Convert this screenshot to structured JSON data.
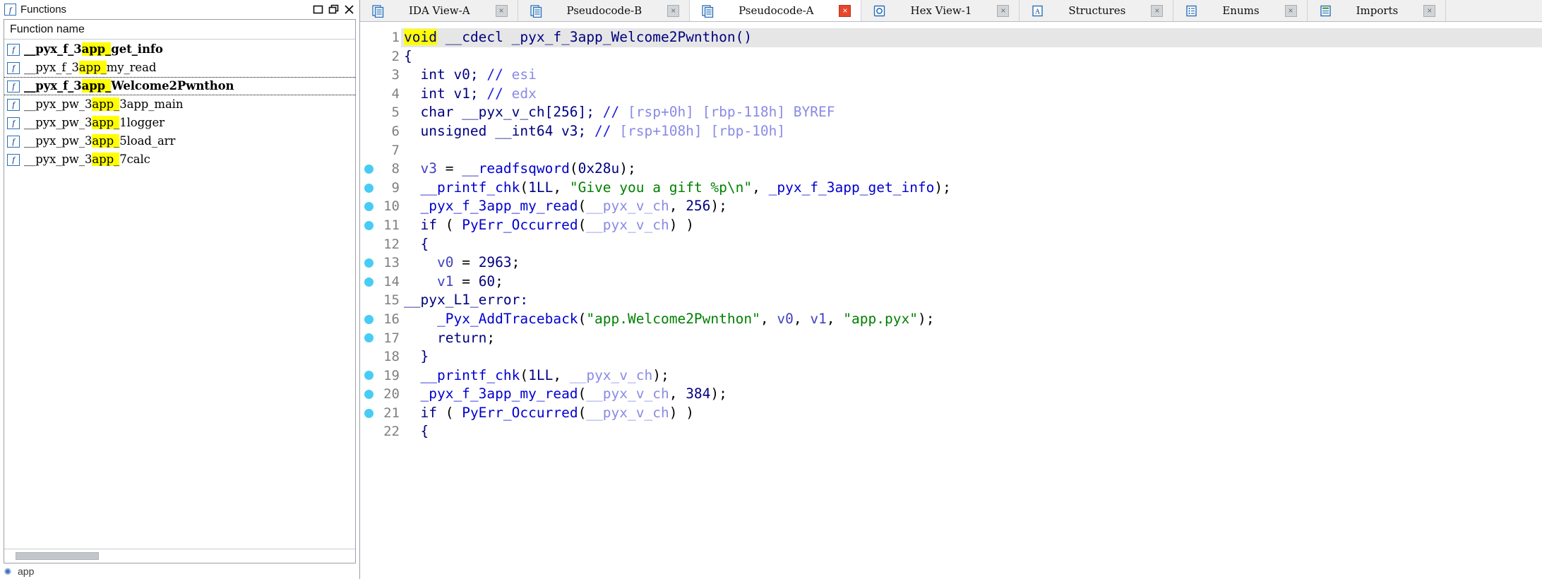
{
  "left_dock": {
    "title": "Functions",
    "title_icon": "function-window-icon",
    "window_buttons": [
      {
        "name": "restore-button",
        "glyph": "restore"
      },
      {
        "name": "maximize-button",
        "glyph": "maximize"
      },
      {
        "name": "close-button",
        "glyph": "close"
      }
    ],
    "column_header": "Function name",
    "functions": [
      {
        "pre": "__pyx_f_3",
        "hl": "app_",
        "post": "get_info",
        "bold": true,
        "selected": false
      },
      {
        "pre": "__pyx_f_3",
        "hl": "app_",
        "post": "my_read",
        "bold": false,
        "selected": false
      },
      {
        "pre": "__pyx_f_3",
        "hl": "app_",
        "post": "Welcome2Pwnthon",
        "bold": true,
        "selected": true
      },
      {
        "pre": "__pyx_pw_3",
        "hl": "app_",
        "post": "3app_main",
        "bold": false,
        "selected": false
      },
      {
        "pre": "__pyx_pw_3",
        "hl": "app_",
        "post": "1logger",
        "bold": false,
        "selected": false
      },
      {
        "pre": "__pyx_pw_3",
        "hl": "app_",
        "post": "5load_arr",
        "bold": false,
        "selected": false
      },
      {
        "pre": "__pyx_pw_3",
        "hl": "app_",
        "post": "7calc",
        "bold": false,
        "selected": false
      }
    ],
    "status_text": "app",
    "status_icon": "python-icon"
  },
  "tabs": [
    {
      "label": "IDA View-A",
      "icon": "document-icon",
      "active": false,
      "closable": true
    },
    {
      "label": "Pseudocode-B",
      "icon": "document-icon",
      "active": false,
      "closable": true
    },
    {
      "label": "Pseudocode-A",
      "icon": "document-icon",
      "active": true,
      "closable": true
    },
    {
      "label": "Hex View-1",
      "icon": "hex-icon",
      "active": false,
      "closable": true
    },
    {
      "label": "Structures",
      "icon": "structures-icon",
      "active": false,
      "closable": true
    },
    {
      "label": "Enums",
      "icon": "enums-icon",
      "active": false,
      "closable": true
    },
    {
      "label": "Imports",
      "icon": "imports-icon",
      "active": false,
      "closable": true
    }
  ],
  "code": {
    "lines": [
      {
        "n": 1,
        "bp": false,
        "hl_row": true,
        "tokens": [
          {
            "t": "void",
            "c": "t-hl"
          },
          {
            "t": " ",
            "c": "t-plain"
          },
          {
            "t": "__cdecl",
            "c": "t-kw"
          },
          {
            "t": " ",
            "c": "t-plain"
          },
          {
            "t": "_pyx_f_3app_Welcome2Pwnthon",
            "c": "t-kw"
          },
          {
            "t": "()",
            "c": "t-kw"
          }
        ]
      },
      {
        "n": 2,
        "bp": false,
        "hl_row": false,
        "tokens": [
          {
            "t": "{",
            "c": "t-kw"
          }
        ]
      },
      {
        "n": 3,
        "bp": false,
        "hl_row": false,
        "tokens": [
          {
            "t": "  int v0; ",
            "c": "t-kw"
          },
          {
            "t": "//",
            "c": "t-cmt"
          },
          {
            "t": " ",
            "c": "t-plain"
          },
          {
            "t": "esi",
            "c": "t-reg"
          }
        ]
      },
      {
        "n": 4,
        "bp": false,
        "hl_row": false,
        "tokens": [
          {
            "t": "  int v1; ",
            "c": "t-kw"
          },
          {
            "t": "//",
            "c": "t-cmt"
          },
          {
            "t": " ",
            "c": "t-plain"
          },
          {
            "t": "edx",
            "c": "t-reg"
          }
        ]
      },
      {
        "n": 5,
        "bp": false,
        "hl_row": false,
        "tokens": [
          {
            "t": "  char __pyx_v_ch[256]; ",
            "c": "t-kw"
          },
          {
            "t": "//",
            "c": "t-cmt"
          },
          {
            "t": " ",
            "c": "t-plain"
          },
          {
            "t": "[rsp+0h] [rbp-118h] BYREF",
            "c": "t-reg"
          }
        ]
      },
      {
        "n": 6,
        "bp": false,
        "hl_row": false,
        "tokens": [
          {
            "t": "  unsigned __int64 v3; ",
            "c": "t-kw"
          },
          {
            "t": "//",
            "c": "t-cmt"
          },
          {
            "t": " ",
            "c": "t-plain"
          },
          {
            "t": "[rsp+108h] [rbp-10h]",
            "c": "t-reg"
          }
        ]
      },
      {
        "n": 7,
        "bp": false,
        "hl_row": false,
        "tokens": []
      },
      {
        "n": 8,
        "bp": true,
        "hl_row": false,
        "tokens": [
          {
            "t": "  ",
            "c": "t-plain"
          },
          {
            "t": "v3",
            "c": "t-var"
          },
          {
            "t": " = ",
            "c": "t-plain"
          },
          {
            "t": "__readfsqword",
            "c": "t-glob"
          },
          {
            "t": "(",
            "c": "t-plain"
          },
          {
            "t": "0x28u",
            "c": "t-num"
          },
          {
            "t": ");",
            "c": "t-plain"
          }
        ]
      },
      {
        "n": 9,
        "bp": true,
        "hl_row": false,
        "tokens": [
          {
            "t": "  ",
            "c": "t-plain"
          },
          {
            "t": "__printf_chk",
            "c": "t-glob"
          },
          {
            "t": "(",
            "c": "t-plain"
          },
          {
            "t": "1LL",
            "c": "t-num"
          },
          {
            "t": ", ",
            "c": "t-plain"
          },
          {
            "t": "\"Give you a gift %p\\n\"",
            "c": "t-str"
          },
          {
            "t": ", ",
            "c": "t-plain"
          },
          {
            "t": "_pyx_f_3app_get_info",
            "c": "t-glob"
          },
          {
            "t": ");",
            "c": "t-plain"
          }
        ]
      },
      {
        "n": 10,
        "bp": true,
        "hl_row": false,
        "tokens": [
          {
            "t": "  ",
            "c": "t-plain"
          },
          {
            "t": "_pyx_f_3app_my_read",
            "c": "t-glob"
          },
          {
            "t": "(",
            "c": "t-plain"
          },
          {
            "t": "__pyx_v_ch",
            "c": "t-reg"
          },
          {
            "t": ", ",
            "c": "t-plain"
          },
          {
            "t": "256",
            "c": "t-num"
          },
          {
            "t": ");",
            "c": "t-plain"
          }
        ]
      },
      {
        "n": 11,
        "bp": true,
        "hl_row": false,
        "tokens": [
          {
            "t": "  ",
            "c": "t-plain"
          },
          {
            "t": "if",
            "c": "t-kw"
          },
          {
            "t": " ( ",
            "c": "t-plain"
          },
          {
            "t": "PyErr_Occurred",
            "c": "t-glob"
          },
          {
            "t": "(",
            "c": "t-plain"
          },
          {
            "t": "__pyx_v_ch",
            "c": "t-reg"
          },
          {
            "t": ") )",
            "c": "t-plain"
          }
        ]
      },
      {
        "n": 12,
        "bp": false,
        "hl_row": false,
        "tokens": [
          {
            "t": "  {",
            "c": "t-kw"
          }
        ]
      },
      {
        "n": 13,
        "bp": true,
        "hl_row": false,
        "tokens": [
          {
            "t": "    ",
            "c": "t-plain"
          },
          {
            "t": "v0",
            "c": "t-var"
          },
          {
            "t": " = ",
            "c": "t-plain"
          },
          {
            "t": "2963",
            "c": "t-num"
          },
          {
            "t": ";",
            "c": "t-plain"
          }
        ]
      },
      {
        "n": 14,
        "bp": true,
        "hl_row": false,
        "tokens": [
          {
            "t": "    ",
            "c": "t-plain"
          },
          {
            "t": "v1",
            "c": "t-var"
          },
          {
            "t": " = ",
            "c": "t-plain"
          },
          {
            "t": "60",
            "c": "t-num"
          },
          {
            "t": ";",
            "c": "t-plain"
          }
        ]
      },
      {
        "n": 15,
        "bp": false,
        "hl_row": false,
        "tokens": [
          {
            "t": "__pyx_L1_error:",
            "c": "t-lbl"
          }
        ]
      },
      {
        "n": 16,
        "bp": true,
        "hl_row": false,
        "tokens": [
          {
            "t": "    ",
            "c": "t-plain"
          },
          {
            "t": "_Pyx_AddTraceback",
            "c": "t-glob"
          },
          {
            "t": "(",
            "c": "t-plain"
          },
          {
            "t": "\"app.Welcome2Pwnthon\"",
            "c": "t-str"
          },
          {
            "t": ", ",
            "c": "t-plain"
          },
          {
            "t": "v0",
            "c": "t-var"
          },
          {
            "t": ", ",
            "c": "t-plain"
          },
          {
            "t": "v1",
            "c": "t-var"
          },
          {
            "t": ", ",
            "c": "t-plain"
          },
          {
            "t": "\"app.pyx\"",
            "c": "t-str"
          },
          {
            "t": ");",
            "c": "t-plain"
          }
        ]
      },
      {
        "n": 17,
        "bp": true,
        "hl_row": false,
        "tokens": [
          {
            "t": "    ",
            "c": "t-plain"
          },
          {
            "t": "return",
            "c": "t-kw"
          },
          {
            "t": ";",
            "c": "t-plain"
          }
        ]
      },
      {
        "n": 18,
        "bp": false,
        "hl_row": false,
        "tokens": [
          {
            "t": "  }",
            "c": "t-kw"
          }
        ]
      },
      {
        "n": 19,
        "bp": true,
        "hl_row": false,
        "tokens": [
          {
            "t": "  ",
            "c": "t-plain"
          },
          {
            "t": "__printf_chk",
            "c": "t-glob"
          },
          {
            "t": "(",
            "c": "t-plain"
          },
          {
            "t": "1LL",
            "c": "t-num"
          },
          {
            "t": ", ",
            "c": "t-plain"
          },
          {
            "t": "__pyx_v_ch",
            "c": "t-reg"
          },
          {
            "t": ");",
            "c": "t-plain"
          }
        ]
      },
      {
        "n": 20,
        "bp": true,
        "hl_row": false,
        "tokens": [
          {
            "t": "  ",
            "c": "t-plain"
          },
          {
            "t": "_pyx_f_3app_my_read",
            "c": "t-glob"
          },
          {
            "t": "(",
            "c": "t-plain"
          },
          {
            "t": "__pyx_v_ch",
            "c": "t-reg"
          },
          {
            "t": ", ",
            "c": "t-plain"
          },
          {
            "t": "384",
            "c": "t-num"
          },
          {
            "t": ");",
            "c": "t-plain"
          }
        ]
      },
      {
        "n": 21,
        "bp": true,
        "hl_row": false,
        "tokens": [
          {
            "t": "  ",
            "c": "t-plain"
          },
          {
            "t": "if",
            "c": "t-kw"
          },
          {
            "t": " ( ",
            "c": "t-plain"
          },
          {
            "t": "PyErr_Occurred",
            "c": "t-glob"
          },
          {
            "t": "(",
            "c": "t-plain"
          },
          {
            "t": "__pyx_v_ch",
            "c": "t-reg"
          },
          {
            "t": ") )",
            "c": "t-plain"
          }
        ]
      },
      {
        "n": 22,
        "bp": false,
        "hl_row": false,
        "tokens": [
          {
            "t": "  {",
            "c": "t-kw"
          }
        ]
      }
    ]
  },
  "colors": {
    "highlight_yellow": "#ffff00",
    "breakpoint_blue": "#47cdf5",
    "active_tab_close_red": "#e8462a",
    "keyword_navy": "#000080",
    "string_green": "#008000",
    "comment_blue": "#2020e0",
    "register_lavender": "#8a8ae6",
    "line_number_gray": "#808080",
    "current_line_gray": "#e6e6e6"
  }
}
